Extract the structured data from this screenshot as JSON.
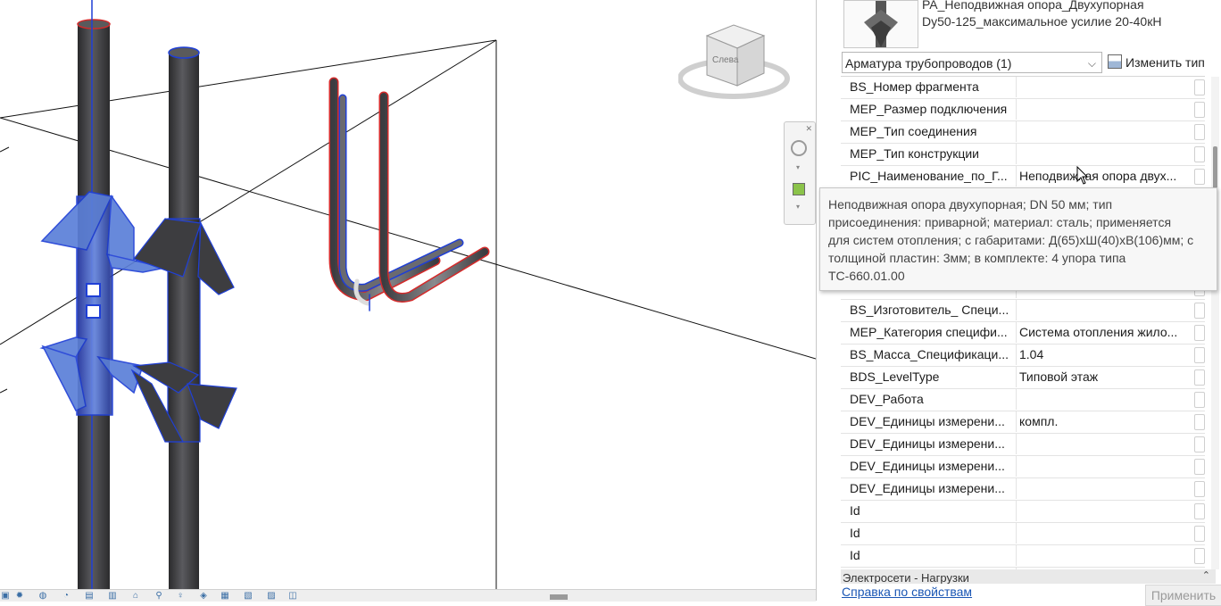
{
  "family": {
    "name_line1": "PA_Неподвижная опора_Двухупорная",
    "name_line2": "Dy50-125_максимальное усилие 20-40кН"
  },
  "selector": {
    "category": "Арматура трубопроводов (1)",
    "edit_type_label": "Изменить тип"
  },
  "viewcube": {
    "face_label": "Слева"
  },
  "properties": [
    {
      "name": "BS_Номер фрагмента",
      "value": ""
    },
    {
      "name": "MEP_Размер подключения",
      "value": ""
    },
    {
      "name": "MEP_Тип соединения",
      "value": ""
    },
    {
      "name": "MEP_Тип конструкции",
      "value": ""
    },
    {
      "name": "PIC_Наименование_по_Г...",
      "value": "Неподвижная опора двух..."
    },
    {
      "name": "",
      "value": ""
    },
    {
      "name": "",
      "value": ""
    },
    {
      "name": "",
      "value": ""
    },
    {
      "name": "",
      "value": ""
    },
    {
      "name": "",
      "value": ""
    },
    {
      "name": "BS_Изготовитель_ Специ...",
      "value": ""
    },
    {
      "name": "MEP_Категория специфи...",
      "value": "Система отопления жило..."
    },
    {
      "name": "BS_Масса_Спецификаци...",
      "value": "1.04"
    },
    {
      "name": "BDS_LevelType",
      "value": "Типовой этаж"
    },
    {
      "name": "DEV_Работа",
      "value": ""
    },
    {
      "name": "DEV_Единицы измерени...",
      "value": "компл."
    },
    {
      "name": "DEV_Единицы измерени...",
      "value": ""
    },
    {
      "name": "DEV_Единицы измерени...",
      "value": ""
    },
    {
      "name": "DEV_Единицы измерени...",
      "value": ""
    },
    {
      "name": "Id",
      "value": ""
    },
    {
      "name": "Id",
      "value": ""
    },
    {
      "name": "Id",
      "value": ""
    },
    {
      "name": "Id",
      "value": ""
    }
  ],
  "group_header": "Электросети - Нагрузки",
  "tooltip": {
    "lines": [
      "Неподвижная опора двухупорная; DN 50 мм; тип",
      "присоединения: приварной; материал: сталь; применяется",
      "для систем отопления; с габаритами: Д(65)хШ(40)хВ(106)мм; с",
      "толщиной пластин: 3мм; в комплекте: 4 упора типа",
      "ТС-660.01.00"
    ]
  },
  "footer": {
    "help_link": "Справка по свойствам",
    "apply_label": "Применить"
  },
  "colors": {
    "selection_blue": "#1f3fd6",
    "pipe_dark": "#3a3a3c",
    "pipe_edge_red": "#d42a2a",
    "link_blue": "#1a56b4"
  }
}
